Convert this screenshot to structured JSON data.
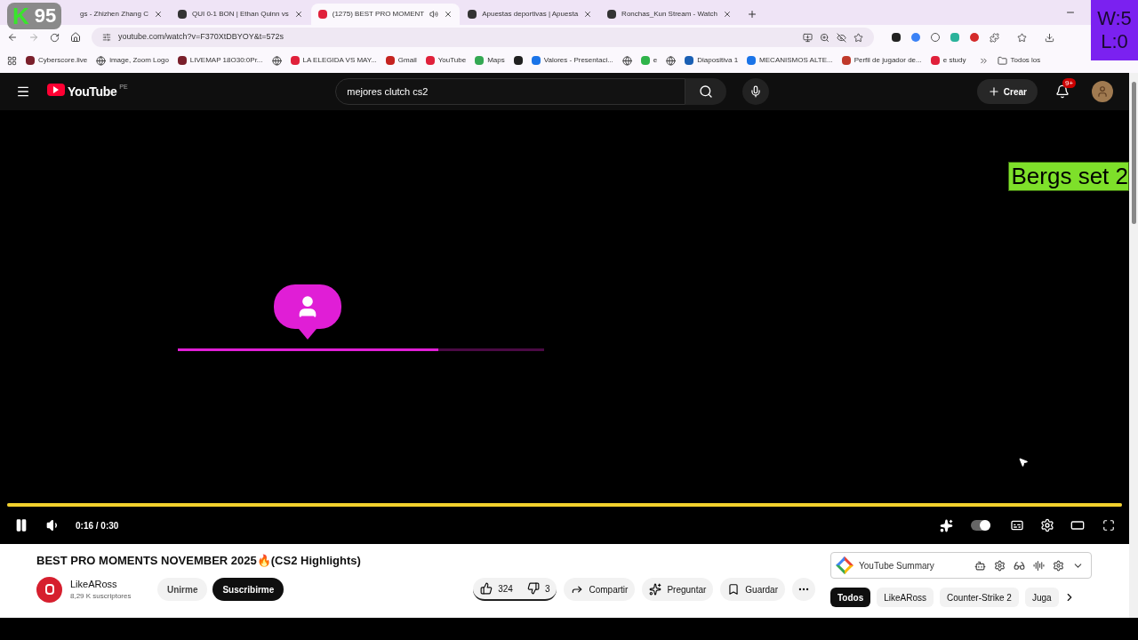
{
  "overlays": {
    "score_badge": {
      "letter": "K",
      "value": "95"
    },
    "record": [
      "W:5",
      "L:0"
    ],
    "label": "Bergs set 2"
  },
  "browser": {
    "tabs": [
      {
        "title": "gs - Zhizhen Zhang C",
        "selected": false,
        "audio": false
      },
      {
        "title": "QUI 0-1 BON | Ethan Quinn vs",
        "selected": false,
        "audio": false
      },
      {
        "title": "(1275) BEST PRO MOMENT",
        "selected": true,
        "audio": true
      },
      {
        "title": "Apuestas deportivas | Apuesta",
        "selected": false,
        "audio": false
      },
      {
        "title": "Ronchas_Kun Stream - Watch",
        "selected": false,
        "audio": false
      }
    ],
    "url": "youtube.com/watch?v=F370XtDBYOY&t=572s",
    "bookmarks": [
      {
        "kind": "site",
        "label": "Cyberscore.live",
        "color": "#7a1f2b"
      },
      {
        "kind": "globe",
        "label": "image, Zoom Logo"
      },
      {
        "kind": "site",
        "label": "LIVEMAP 18O30:0Pr...",
        "color": "#7a1f2b"
      },
      {
        "kind": "globe"
      },
      {
        "kind": "site",
        "label": "LA ELEGIDA VS MAY...",
        "color": "#e0203a"
      },
      {
        "kind": "site",
        "label": "Gmail",
        "color": "#c5221f"
      },
      {
        "kind": "site",
        "label": "YouTube",
        "color": "#e0203a"
      },
      {
        "kind": "site",
        "label": "Maps",
        "color": "#34a853"
      },
      {
        "kind": "site",
        "color": "#202020"
      },
      {
        "kind": "site",
        "label": "Valores - Presentaci...",
        "color": "#1a73e8"
      },
      {
        "kind": "globe"
      },
      {
        "kind": "site",
        "label": "e",
        "color": "#2fb34a"
      },
      {
        "kind": "globe"
      },
      {
        "kind": "site",
        "label": "Diapositiva 1",
        "color": "#1a5fb4"
      },
      {
        "kind": "site",
        "label": "MECANISMOS ALTE...",
        "color": "#1a73e8"
      },
      {
        "kind": "site",
        "label": "Perfil de jugador de...",
        "color": "#c0392b"
      },
      {
        "kind": "site",
        "label": "e study",
        "color": "#e0203a"
      }
    ],
    "all_bookmarks": "Todos los"
  },
  "youtube": {
    "logo": "YouTube",
    "region": "PE",
    "search": {
      "value": "mejores clutch cs2"
    },
    "create": "Crear",
    "notifications": "9+"
  },
  "player": {
    "overlay_progress": {
      "level": 0.71
    },
    "progress": {
      "level": 1
    },
    "playing": true,
    "time": "0:16 / 0:30",
    "autoplay": true
  },
  "video": {
    "title": "BEST PRO MOMENTS NOVEMBER 2025🔥(CS2 Highlights)",
    "channel": {
      "name": "LikeARoss",
      "subscribers": "8,29 K suscriptores"
    },
    "join": "Unirme",
    "subscribe": "Suscribirme",
    "likes": "324",
    "dislikes": "3",
    "actions": [
      "Compartir",
      "Preguntar",
      "Guardar"
    ]
  },
  "summary": {
    "title": "YouTube Summary"
  },
  "chips": [
    {
      "label": "Todos",
      "selected": true
    },
    {
      "label": "LikeARoss",
      "selected": false
    },
    {
      "label": "Counter-Strike 2",
      "selected": false
    },
    {
      "label": "Juga",
      "selected": false
    }
  ]
}
